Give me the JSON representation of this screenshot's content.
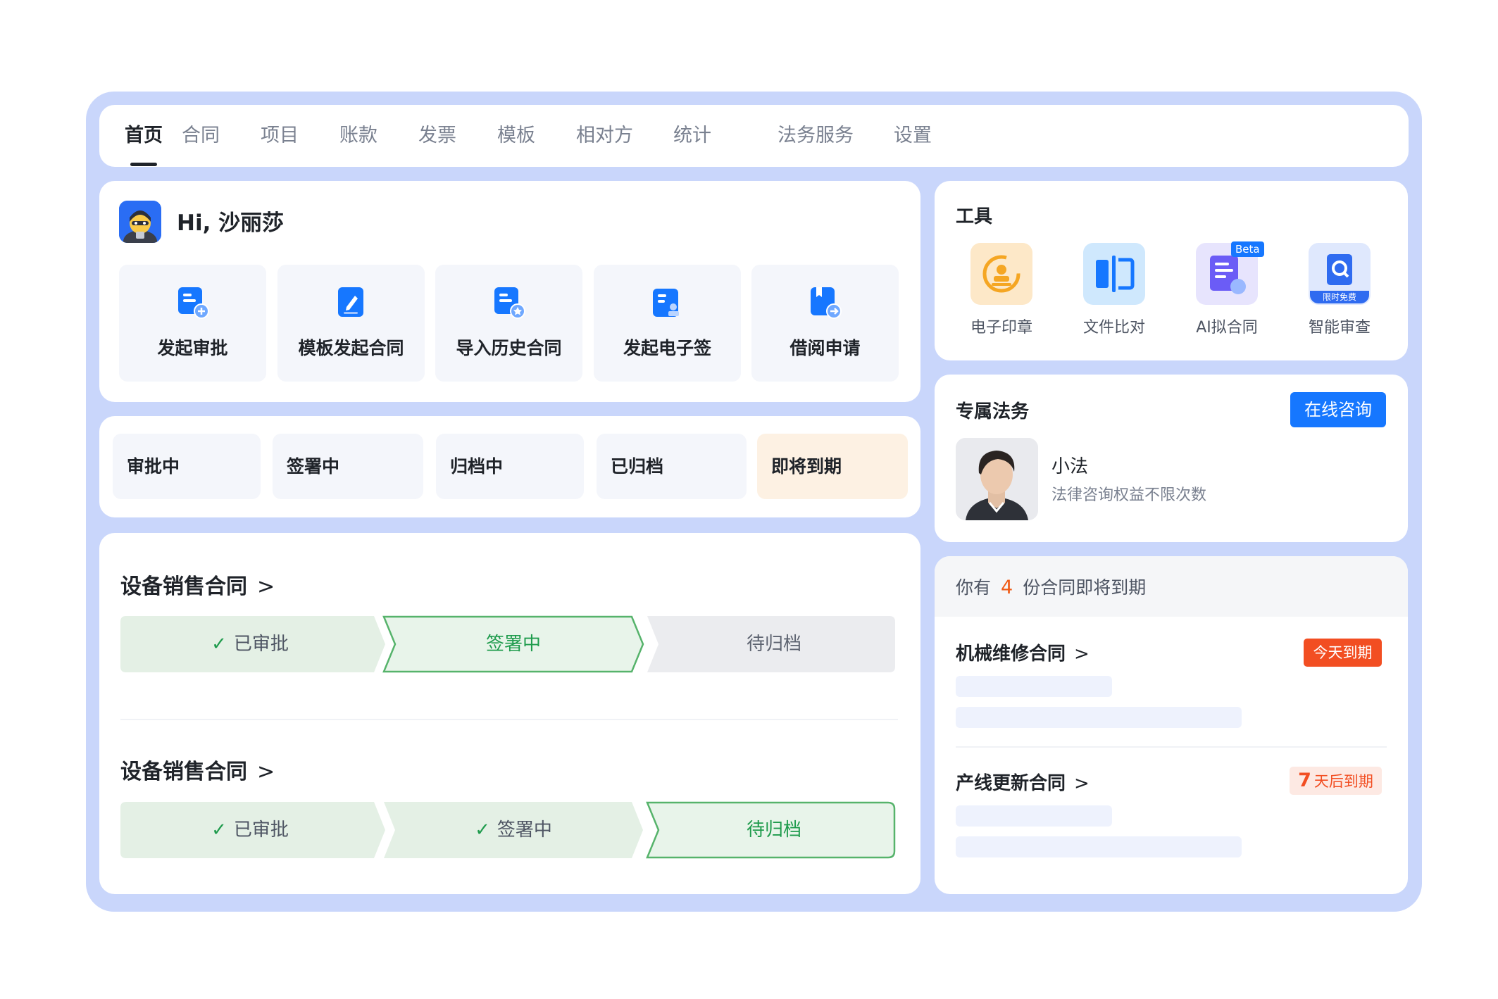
{
  "nav": {
    "tabs": [
      {
        "label": "首页",
        "active": true
      },
      {
        "label": "合同"
      },
      {
        "label": "项目"
      },
      {
        "label": "账款"
      },
      {
        "label": "发票"
      },
      {
        "label": "模板"
      },
      {
        "label": "相对方"
      },
      {
        "label": "统计"
      },
      {
        "label": "法务服务"
      },
      {
        "label": "设置"
      }
    ]
  },
  "greeting": {
    "title": "Hi, 沙丽莎",
    "actions": [
      {
        "label": "发起审批",
        "icon": "approval-add-icon"
      },
      {
        "label": "模板发起合同",
        "icon": "template-edit-icon"
      },
      {
        "label": "导入历史合同",
        "icon": "import-history-icon"
      },
      {
        "label": "发起电子签",
        "icon": "e-sign-icon"
      },
      {
        "label": "借阅申请",
        "icon": "borrow-request-icon"
      }
    ]
  },
  "status_tabs": [
    {
      "label": "审批中"
    },
    {
      "label": "签署中"
    },
    {
      "label": "归档中"
    },
    {
      "label": "已归档"
    },
    {
      "label": "即将到期",
      "highlight": true
    }
  ],
  "contracts": [
    {
      "title": "设备销售合同",
      "steps": [
        {
          "label": "已审批",
          "state": "done"
        },
        {
          "label": "签署中",
          "state": "current"
        },
        {
          "label": "待归档",
          "state": "pending"
        }
      ]
    },
    {
      "title": "设备销售合同",
      "steps": [
        {
          "label": "已审批",
          "state": "done"
        },
        {
          "label": "签署中",
          "state": "done"
        },
        {
          "label": "待归档",
          "state": "current"
        }
      ]
    }
  ],
  "tools": {
    "title": "工具",
    "items": [
      {
        "label": "电子印章",
        "icon": "seal-icon",
        "color": "#f5a623"
      },
      {
        "label": "文件比对",
        "icon": "compare-icon",
        "color": "#1677ff"
      },
      {
        "label": "AI拟合同",
        "icon": "ai-contract-icon",
        "badge": "Beta",
        "color": "#6b5cf6"
      },
      {
        "label": "智能审查",
        "icon": "smart-review-icon",
        "badge": "限时免费",
        "color": "#2f6bf0"
      }
    ]
  },
  "legal": {
    "title": "专属法务",
    "consult_button": "在线咨询",
    "name": "小法",
    "desc": "法律咨询权益不限次数"
  },
  "expiring": {
    "prefix": "你有",
    "count": "4",
    "suffix": "份合同即将到期",
    "items": [
      {
        "title": "机械维修合同",
        "badge": "今天到期"
      },
      {
        "title": "产线更新合同",
        "badge_num": "7",
        "badge_text": "天后到期"
      }
    ]
  },
  "colors": {
    "shell": "#c9d6fb",
    "primary": "#1677ff",
    "success": "#1e9b4c",
    "warning_bg": "#fdf1e3",
    "danger": "#f24e22"
  }
}
